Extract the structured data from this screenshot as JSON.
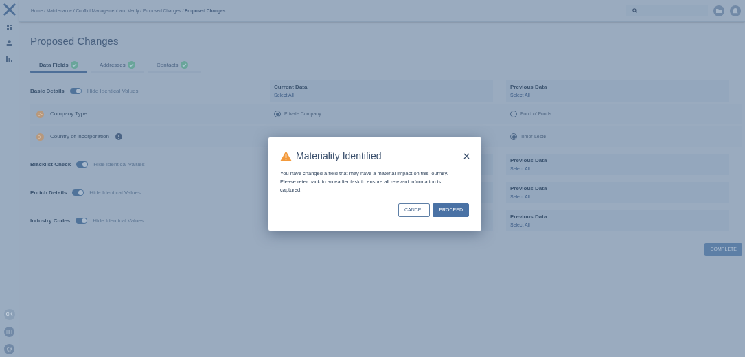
{
  "breadcrumb": "Home / Maintenance / Conflict Management and Verify / Proposed Changes / **Proposed Changes**",
  "sidebar": {
    "avatar_initials": "CK"
  },
  "page_title": "Proposed Changes",
  "tabs": [
    {
      "label": "Data Fields",
      "selected": true,
      "done": true
    },
    {
      "label": "Addresses",
      "selected": false,
      "done": true
    },
    {
      "label": "Contacts",
      "selected": false,
      "done": true
    }
  ],
  "sections": [
    {
      "title": "Basic Details",
      "toggle": {
        "on": true,
        "label": "Hide Identical Values"
      },
      "current": {
        "heading": "Current Data",
        "select_all": "Select All"
      },
      "previous": {
        "heading": "Previous Data",
        "select_all": "Select All"
      },
      "fields": [
        {
          "label": "Company Type",
          "info": false,
          "current": {
            "value": "Private Company",
            "selected": true
          },
          "previous": {
            "value": "Fund of Funds",
            "selected": false
          }
        },
        {
          "label": "Country of Incorporation",
          "info": true,
          "previous": {
            "value": "Timor-Leste",
            "selected": true
          }
        }
      ]
    },
    {
      "title": "Blacklist Check",
      "toggle": {
        "on": true,
        "label": "Hide Identical Values"
      },
      "previous": {
        "heading": "Previous Data",
        "select_all": "Select All"
      }
    },
    {
      "title": "Enrich Details",
      "toggle": {
        "on": true,
        "label": "Hide Identical Values"
      },
      "previous": {
        "heading": "Previous Data",
        "select_all": "Select All"
      }
    },
    {
      "title": "Industry Codes",
      "toggle": {
        "on": true,
        "label": "Hide Identical Values"
      },
      "previous": {
        "heading": "Previous Data",
        "select_all": "Select All"
      }
    }
  ],
  "complete_button": "COMPLETE",
  "dialog": {
    "title": "Materiality Identified",
    "message": "You have changed a field that may have a material impact on this journey. Please refer back to an earlier task to ensure all relevant information is captured.",
    "buttons": [
      {
        "label": "CANCEL",
        "kind": "secondary"
      },
      {
        "label": "PROCEED",
        "kind": "primary"
      }
    ]
  }
}
